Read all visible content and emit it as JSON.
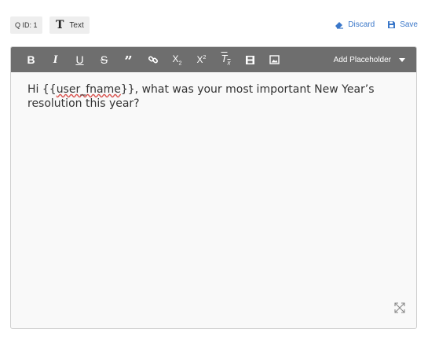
{
  "header": {
    "qid_label": "Q ID: 1",
    "type_label": "Text",
    "type_icon": "text-type-icon",
    "discard_label": "Discard",
    "save_label": "Save",
    "accent_color": "#3a77c9"
  },
  "toolbar": {
    "buttons": [
      "bold",
      "italic",
      "underline",
      "strikethrough",
      "blockquote",
      "link",
      "subscript",
      "superscript",
      "clear-format",
      "video",
      "image"
    ],
    "add_placeholder_label": "Add Placeholder",
    "background": "#6e6e6e"
  },
  "editor": {
    "text_before": "Hi {{",
    "merge_field": "user_fname",
    "text_after": "}}, what was your most important New Year’s resolution this year?"
  }
}
